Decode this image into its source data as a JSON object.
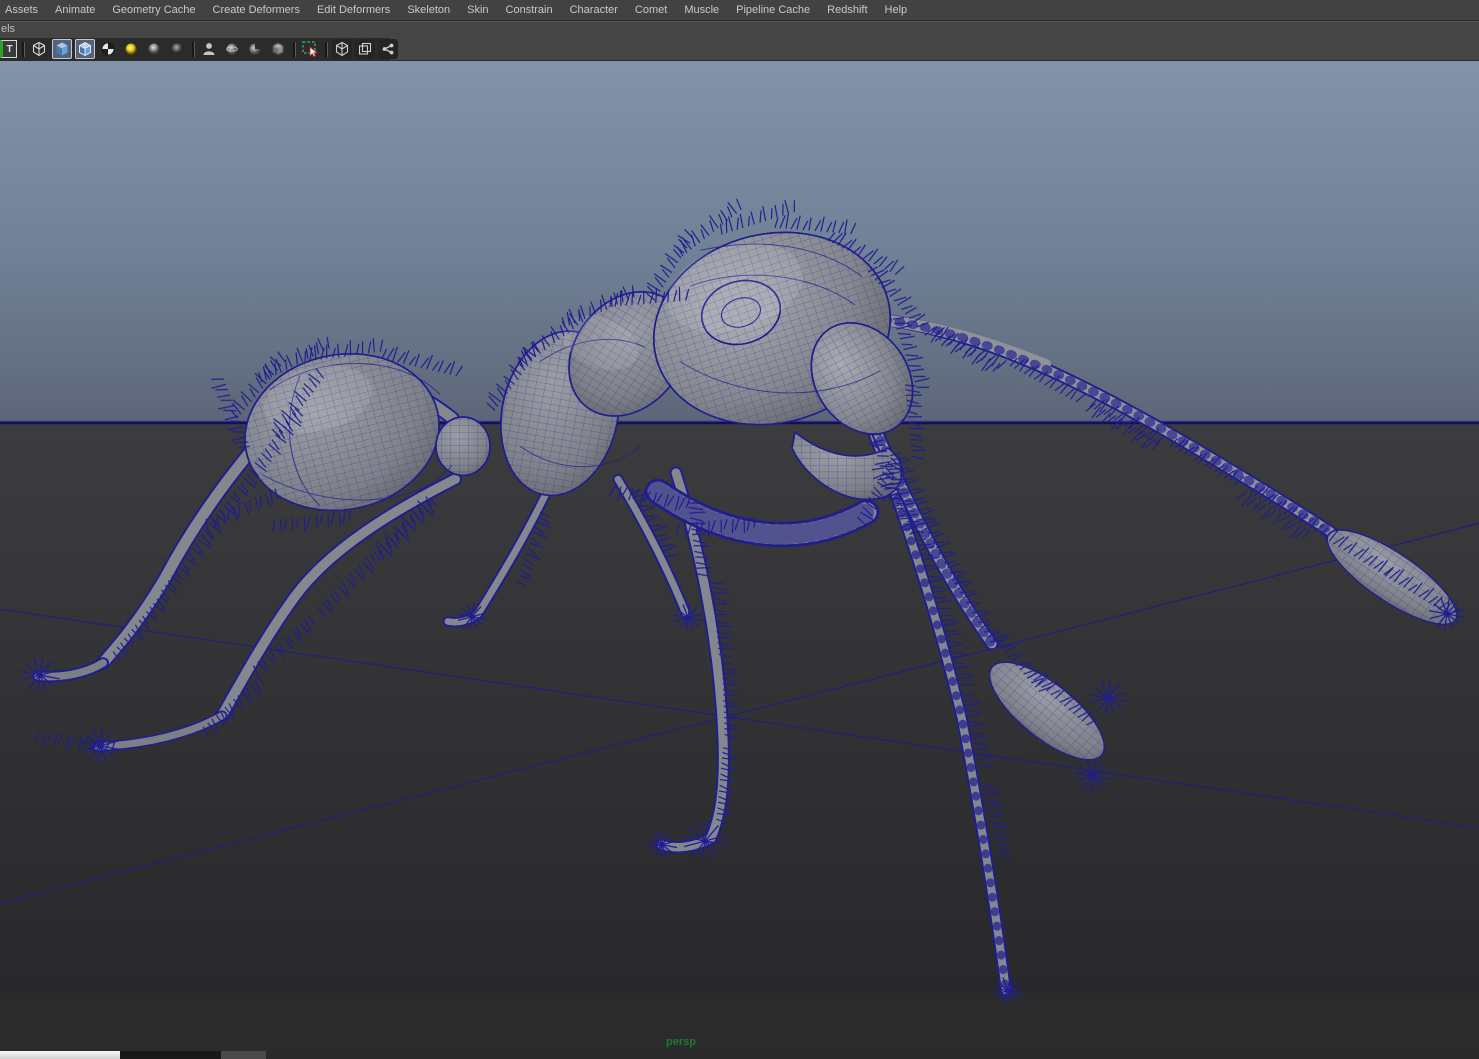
{
  "menu_bar": {
    "items": [
      "Assets",
      "Animate",
      "Geometry Cache",
      "Create Deformers",
      "Edit Deformers",
      "Skeleton",
      "Skin",
      "Constrain",
      "Character",
      "Comet",
      "Muscle",
      "Pipeline Cache",
      "Redshift",
      "Help"
    ]
  },
  "panel_header": {
    "truncated_text": "els"
  },
  "toolbar": {
    "icons": [
      {
        "name": "partial-letter-t-icon",
        "active": false
      },
      {
        "name": "wireframe-cube-icon",
        "active": false
      },
      {
        "name": "smooth-shaded-cube-icon",
        "active": true
      },
      {
        "name": "wireframe-on-shaded-icon",
        "active": true
      },
      {
        "name": "textured-checker-sphere-icon",
        "active": false
      },
      {
        "name": "use-all-lights-icon",
        "active": false
      },
      {
        "name": "shadows-sphere-icon",
        "active": false
      },
      {
        "name": "ambient-occlusion-sphere-icon",
        "active": false
      },
      {
        "name": "xray-person-icon",
        "active": false
      },
      {
        "name": "xray-joints-sphere-icon",
        "active": false
      },
      {
        "name": "xray-active-components-icon",
        "active": false
      },
      {
        "name": "motion-blur-cube-icon",
        "active": false
      },
      {
        "name": "isolate-select-icon",
        "active": false
      },
      {
        "name": "scene-cube-icon",
        "active": false
      },
      {
        "name": "multi-pane-icon",
        "active": false
      },
      {
        "name": "node-graph-icon",
        "active": false
      }
    ]
  },
  "viewport": {
    "camera_label": "persp",
    "model": "ant-wireframe-mesh-with-fur",
    "colors": {
      "sky_top": "#8294aa",
      "sky_horizon": "#5d6678",
      "ground_top": "#3c3c3e",
      "ground_bottom": "#28282a",
      "wireframe_blue": "#201e8f",
      "grid_line": "#201f7d",
      "horizon_dark": "#111158",
      "horizon_light": "#3c3c9e",
      "body_gray": "#8b8e94",
      "camera_label_green": "#1d7b33"
    }
  },
  "accents": {
    "active_icon_blue": "#4f8cc9",
    "isolate_green": "#39c46b",
    "light_yellow": "#ffe94a"
  }
}
